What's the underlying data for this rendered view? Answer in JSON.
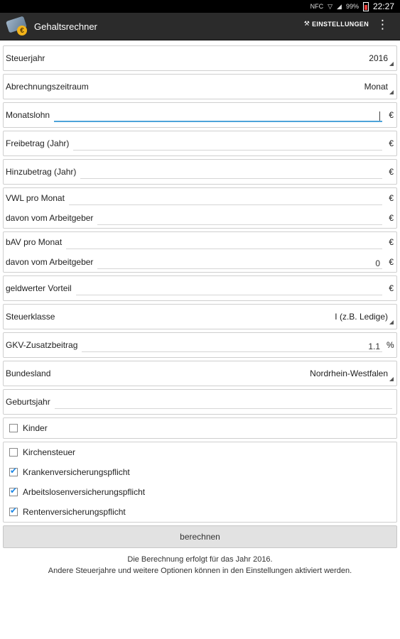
{
  "status": {
    "signal": "NFC",
    "battery": "99%",
    "time": "22:27"
  },
  "app": {
    "title": "Gehaltsrechner",
    "settings_label": "EINSTELLUNGEN",
    "coin_symbol": "€"
  },
  "fields": {
    "steuerjahr": {
      "label": "Steuerjahr",
      "value": "2016"
    },
    "abrechnungszeitraum": {
      "label": "Abrechnungszeitraum",
      "value": "Monat"
    },
    "monatslohn": {
      "label": "Monatslohn",
      "value": "",
      "unit": "€"
    },
    "freibetrag": {
      "label": "Freibetrag (Jahr)",
      "value": "",
      "unit": "€"
    },
    "hinzubetrag": {
      "label": "Hinzubetrag (Jahr)",
      "value": "",
      "unit": "€"
    },
    "vwl": {
      "label": "VWL pro Monat",
      "value": "",
      "unit": "€"
    },
    "vwl_ag": {
      "label": "davon vom Arbeitgeber",
      "value": "",
      "unit": "€"
    },
    "bav": {
      "label": "bAV pro Monat",
      "value": "",
      "unit": "€"
    },
    "bav_ag": {
      "label": "davon vom Arbeitgeber",
      "value": "0",
      "unit": "€"
    },
    "geldwerter": {
      "label": "geldwerter Vorteil",
      "value": "",
      "unit": "€"
    },
    "steuerklasse": {
      "label": "Steuerklasse",
      "value": "I (z.B. Ledige)"
    },
    "gkv": {
      "label": "GKV-Zusatzbeitrag",
      "value": "1.1",
      "unit": "%"
    },
    "bundesland": {
      "label": "Bundesland",
      "value": "Nordrhein-Westfalen"
    },
    "geburtsjahr": {
      "label": "Geburtsjahr",
      "value": ""
    }
  },
  "checkboxes": {
    "kinder": {
      "label": "Kinder",
      "checked": false
    },
    "kirchensteuer": {
      "label": "Kirchensteuer",
      "checked": false
    },
    "kv": {
      "label": "Krankenversicherungspflicht",
      "checked": true
    },
    "av": {
      "label": "Arbeitslosenversicherungspflicht",
      "checked": true
    },
    "rv": {
      "label": "Rentenversicherungspflicht",
      "checked": true
    }
  },
  "button": {
    "label": "berechnen"
  },
  "info": {
    "line1": "Die Berechnung erfolgt für das Jahr 2016.",
    "line2": "Andere Steuerjahre und weitere Optionen können in den Einstellungen aktiviert werden."
  },
  "colors": {
    "accent": "#4da3d9",
    "check": "#1e88e5",
    "actionbar": "#2b2b2b"
  }
}
